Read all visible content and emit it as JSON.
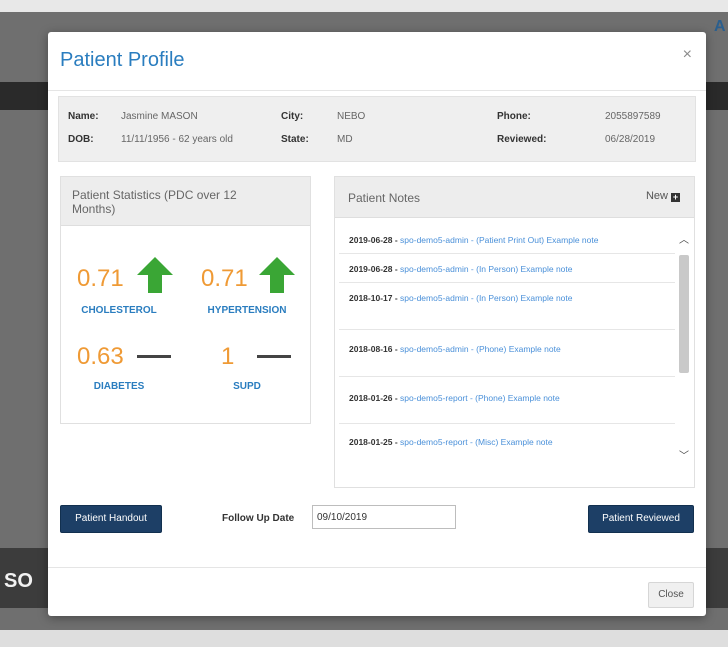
{
  "background": {
    "left_text": "SO",
    "right_letter": "A"
  },
  "modal": {
    "title": "Patient Profile",
    "close_x": "×"
  },
  "patient": {
    "name_label": "Name:",
    "name": "Jasmine MASON",
    "dob_label": "DOB:",
    "dob": "11/11/1956 - 62 years old",
    "city_label": "City:",
    "city": "NEBO",
    "state_label": "State:",
    "state": "MD",
    "phone_label": "Phone:",
    "phone": "2055897589",
    "reviewed_label": "Reviewed:",
    "reviewed": "06/28/2019"
  },
  "stats": {
    "title": "Patient Statistics (PDC over 12 Months)",
    "items": [
      {
        "value": "0.71",
        "label": "CHOLESTEROL",
        "trend": "up"
      },
      {
        "value": "0.71",
        "label": "HYPERTENSION",
        "trend": "up"
      },
      {
        "value": "0.63",
        "label": "DIABETES",
        "trend": "flat"
      },
      {
        "value": "1",
        "label": "SUPD",
        "trend": "flat"
      }
    ],
    "colors": {
      "value": "#ef9a35",
      "label": "#2a7dbf",
      "arrow": "#3aa635"
    }
  },
  "notes": {
    "title": "Patient Notes",
    "new_label": "New",
    "items": [
      {
        "date": "2019-06-28 -",
        "text": "spo-demo5-admin - (Patient Print Out) Example note"
      },
      {
        "date": "2019-06-28 -",
        "text": "spo-demo5-admin - (In Person) Example note"
      },
      {
        "date": "2018-10-17 -",
        "text": "spo-demo5-admin - (In Person) Example note"
      },
      {
        "date": "2018-08-16 -",
        "text": "spo-demo5-admin - (Phone) Example note"
      },
      {
        "date": "2018-01-26 -",
        "text": "spo-demo5-report - (Phone) Example note"
      },
      {
        "date": "2018-01-25 -",
        "text": "spo-demo5-report - (Misc) Example note"
      }
    ]
  },
  "footer": {
    "handout_label": "Patient Handout",
    "followup_label": "Follow Up Date",
    "followup_value": "09/10/2019",
    "reviewed_label": "Patient Reviewed",
    "close_label": "Close"
  }
}
